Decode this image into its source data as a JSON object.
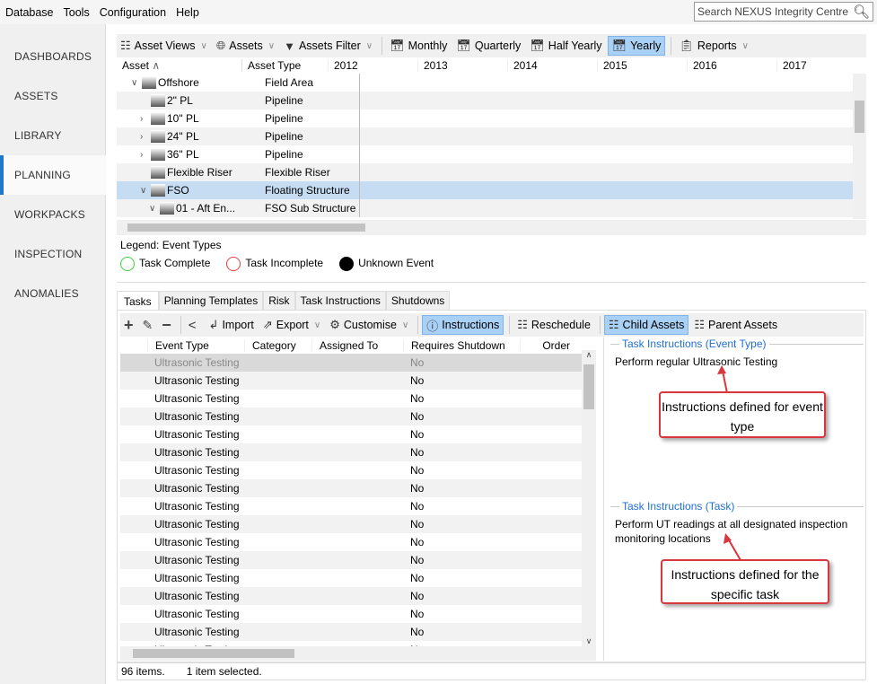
{
  "menu": [
    "Database",
    "Tools",
    "Configuration",
    "Help"
  ],
  "search": {
    "placeholder": "Search NEXUS Integrity Centre"
  },
  "nav": [
    "DASHBOARDS",
    "ASSETS",
    "LIBRARY",
    "PLANNING",
    "WORKPACKS",
    "INSPECTION",
    "ANOMALIES"
  ],
  "nav_selected": "PLANNING",
  "toolbar": {
    "asset_views": "Asset Views",
    "assets": "Assets",
    "assets_filter": "Assets Filter",
    "monthly": "Monthly",
    "quarterly": "Quarterly",
    "half_yearly": "Half Yearly",
    "yearly": "Yearly",
    "reports": "Reports"
  },
  "asset_grid": {
    "headers": {
      "asset": "Asset",
      "asset_type": "Asset Type"
    },
    "years": [
      "2012",
      "2013",
      "2014",
      "2015",
      "2016",
      "2017"
    ],
    "rows": [
      {
        "name": "Offshore",
        "type": "Field Area",
        "indent": 1,
        "expander": "open"
      },
      {
        "name": "2\" PL",
        "type": "Pipeline",
        "indent": 2,
        "expander": "none"
      },
      {
        "name": "10\" PL",
        "type": "Pipeline",
        "indent": 2,
        "expander": "closed"
      },
      {
        "name": "24\" PL",
        "type": "Pipeline",
        "indent": 2,
        "expander": "closed"
      },
      {
        "name": "36\" PL",
        "type": "Pipeline",
        "indent": 2,
        "expander": "closed"
      },
      {
        "name": "Flexible Riser",
        "type": "Flexible Riser",
        "indent": 2,
        "expander": "none"
      },
      {
        "name": "FSO",
        "type": "Floating Structure",
        "indent": 2,
        "expander": "open",
        "selected": true
      },
      {
        "name": "01 - Aft En...",
        "type": "FSO Sub Structure",
        "indent": 3,
        "expander": "open"
      }
    ]
  },
  "legend": {
    "title": "Legend: Event Types",
    "items": [
      {
        "label": "Task Complete",
        "color": "#3cd23c",
        "style": "ring"
      },
      {
        "label": "Task Incomplete",
        "color": "#e04040",
        "style": "ring"
      },
      {
        "label": "Unknown Event",
        "color": "#000000",
        "style": "filled"
      }
    ]
  },
  "tabs": [
    "Tasks",
    "Planning Templates",
    "Risk",
    "Task Instructions",
    "Shutdowns"
  ],
  "tasks_toolbar": {
    "import": "Import",
    "export": "Export",
    "customise": "Customise",
    "instructions": "Instructions",
    "reschedule": "Reschedule",
    "child_assets": "Child Assets",
    "parent_assets": "Parent Assets"
  },
  "tasks_grid": {
    "headers": [
      "Event Type",
      "Category",
      "Assigned To",
      "Requires Shutdown",
      "Order"
    ],
    "rows": [
      [
        "Ultrasonic Testing",
        "",
        "",
        "No",
        ""
      ],
      [
        "Ultrasonic Testing",
        "",
        "",
        "No",
        ""
      ],
      [
        "Ultrasonic Testing",
        "",
        "",
        "No",
        ""
      ],
      [
        "Ultrasonic Testing",
        "",
        "",
        "No",
        ""
      ],
      [
        "Ultrasonic Testing",
        "",
        "",
        "No",
        ""
      ],
      [
        "Ultrasonic Testing",
        "",
        "",
        "No",
        ""
      ],
      [
        "Ultrasonic Testing",
        "",
        "",
        "No",
        ""
      ],
      [
        "Ultrasonic Testing",
        "",
        "",
        "No",
        ""
      ],
      [
        "Ultrasonic Testing",
        "",
        "",
        "No",
        ""
      ],
      [
        "Ultrasonic Testing",
        "",
        "",
        "No",
        ""
      ],
      [
        "Ultrasonic Testing",
        "",
        "",
        "No",
        ""
      ],
      [
        "Ultrasonic Testing",
        "",
        "",
        "No",
        ""
      ],
      [
        "Ultrasonic Testing",
        "",
        "",
        "No",
        ""
      ],
      [
        "Ultrasonic Testing",
        "",
        "",
        "No",
        ""
      ],
      [
        "Ultrasonic Testing",
        "",
        "",
        "No",
        ""
      ],
      [
        "Ultrasonic Testing",
        "",
        "",
        "No",
        ""
      ],
      [
        "Ultrasonic Testing",
        "",
        "",
        "No",
        ""
      ]
    ]
  },
  "instructions": {
    "event_type_title": "Task Instructions (Event Type)",
    "event_type_text": "Perform regular Ultrasonic Testing",
    "task_title": "Task Instructions (Task)",
    "task_text": "Perform UT readings at all designated inspection monitoring locations"
  },
  "callouts": {
    "first": "Instructions defined for event type",
    "second": "Instructions defined for the specific task"
  },
  "status": {
    "items": "96 items.",
    "selected": "1 item selected."
  }
}
